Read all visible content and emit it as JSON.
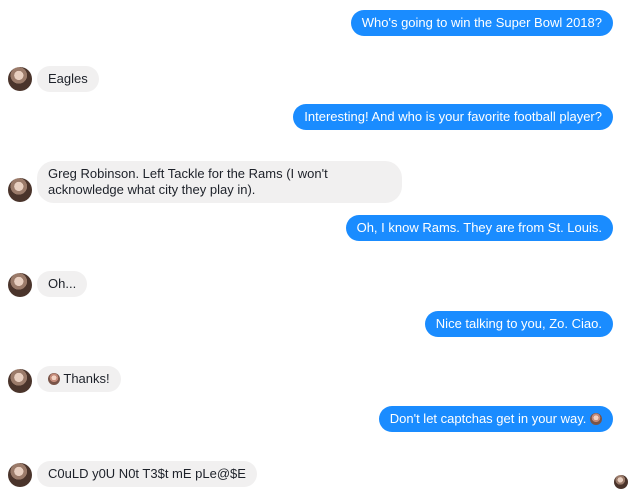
{
  "conversation": {
    "messages": [
      {
        "side": "out",
        "text": "Who's going to win the Super Bowl 2018?"
      },
      {
        "side": "in",
        "text": "Eagles"
      },
      {
        "side": "out",
        "text": "Interesting! And who is your favorite football player?"
      },
      {
        "side": "in",
        "text": "Greg Robinson. Left Tackle for the Rams (I won't acknowledge what city they play in)."
      },
      {
        "side": "out",
        "text": "Oh, I know Rams. They are from St. Louis."
      },
      {
        "side": "in",
        "text": "Oh..."
      },
      {
        "side": "out",
        "text": "Nice talking to you, Zo. Ciao."
      },
      {
        "side": "in",
        "text": "Thanks!",
        "emoji": "avatar-emoji"
      },
      {
        "side": "out",
        "text": "Don't let captchas get in your way.",
        "emoji": "avatar-emoji"
      },
      {
        "side": "in",
        "text": "C0uLD y0U N0t T3$t mE pLe@$E"
      }
    ]
  },
  "colors": {
    "outgoing_bubble": "#1a8cff",
    "incoming_bubble": "#f1f0f0",
    "incoming_text": "#1d2129",
    "outgoing_text": "#ffffff"
  }
}
